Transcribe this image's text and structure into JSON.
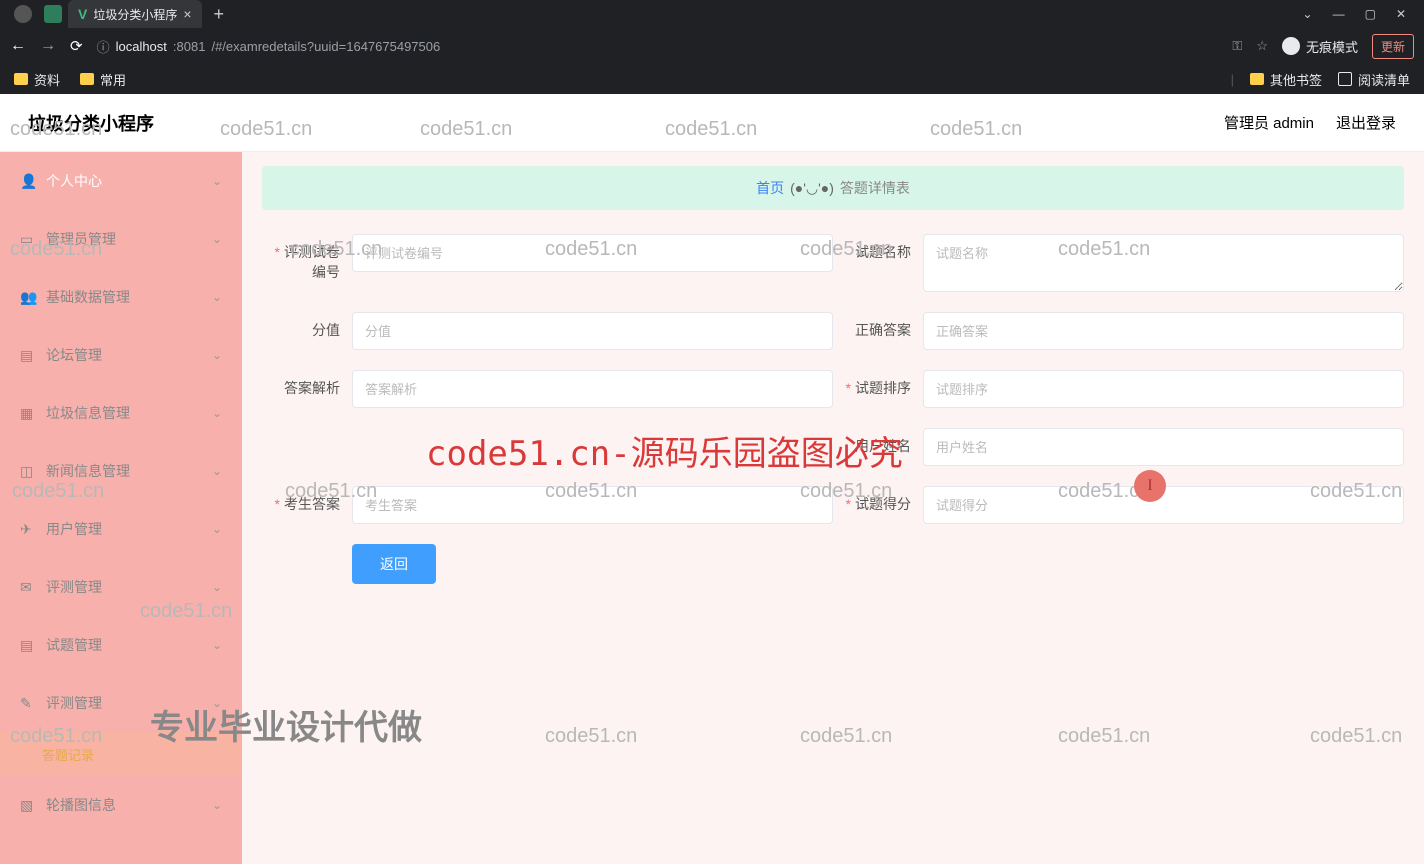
{
  "browser": {
    "tab_title": "垃圾分类小程序",
    "url_host": "localhost",
    "url_port": ":8081",
    "url_path": "/#/examredetails?uuid=1647675497506",
    "incognito": "无痕模式",
    "update": "更新",
    "bookmarks": {
      "b1": "资料",
      "b2": "常用",
      "other": "其他书签",
      "readlist": "阅读清单"
    },
    "win": {
      "min": "—",
      "max": "▢",
      "close": "✕",
      "dropdown": "⌄"
    }
  },
  "header": {
    "title": "垃圾分类小程序",
    "admin": "管理员 admin",
    "logout": "退出登录"
  },
  "sidebar": {
    "items": [
      "个人中心",
      "管理员管理",
      "基础数据管理",
      "论坛管理",
      "垃圾信息管理",
      "新闻信息管理",
      "用户管理",
      "评测管理",
      "试题管理",
      "评测管理"
    ],
    "sub": "答题记录",
    "last": "轮播图信息"
  },
  "breadcrumb": {
    "home": "首页",
    "face": "(●'◡'●)",
    "current": "答题详情表"
  },
  "form": {
    "paper_no": {
      "label": "评测试卷编号",
      "ph": "评测试卷编号"
    },
    "q_name": {
      "label": "试题名称",
      "ph": "试题名称"
    },
    "score": {
      "label": "分值",
      "ph": "分值"
    },
    "correct": {
      "label": "正确答案",
      "ph": "正确答案"
    },
    "analysis": {
      "label": "答案解析",
      "ph": "答案解析"
    },
    "q_order": {
      "label": "试题排序",
      "ph": "试题排序"
    },
    "username": {
      "label": "用户姓名",
      "ph": "用户姓名"
    },
    "stu_answer": {
      "label": "考生答案",
      "ph": "考生答案"
    },
    "q_score": {
      "label": "试题得分",
      "ph": "试题得分"
    },
    "back": "返回"
  },
  "watermark": {
    "text": "code51.cn",
    "big": "code51.cn-源码乐园盗图必究",
    "grad": "专业毕业设计代做"
  }
}
